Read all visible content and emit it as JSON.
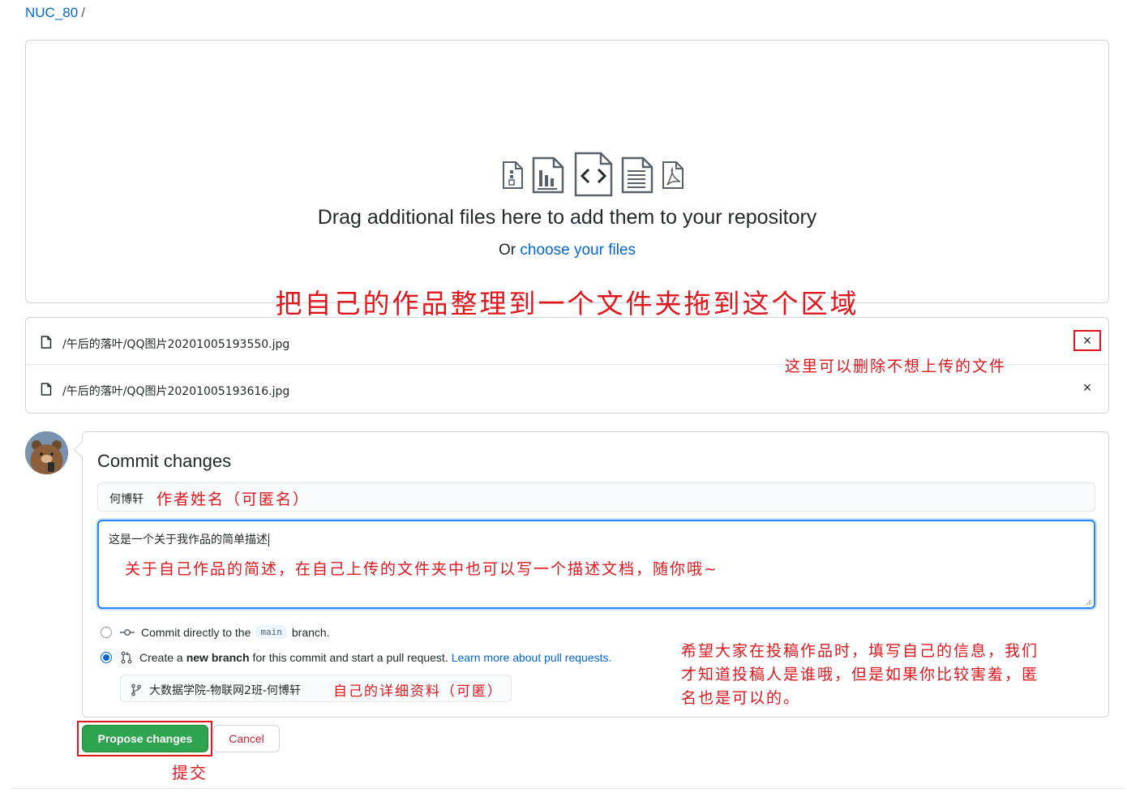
{
  "breadcrumb": {
    "repo": "NUC_80",
    "separator": "/"
  },
  "dropzone": {
    "title": "Drag additional files here to add them to your repository",
    "or_text": "Or",
    "choose_link": "choose your files",
    "annotation": "把自己的作品整理到一个文件夹拖到这个区域",
    "icons": [
      "file-zip-icon",
      "file-chart-icon",
      "file-code-icon",
      "file-text-icon",
      "file-pdf-icon"
    ]
  },
  "files": {
    "items": [
      {
        "name": "/午后的落叶/QQ图片20201005193550.jpg",
        "remove": "×"
      },
      {
        "name": "/午后的落叶/QQ图片20201005193616.jpg",
        "remove": "×"
      }
    ],
    "annotation": "这里可以删除不想上传的文件"
  },
  "commit": {
    "title": "Commit changes",
    "summary_value": "何博轩",
    "summary_annotation": "作者姓名（可匿名）",
    "description_value": "这是一个关于我作品的简单描述",
    "description_annotation": "关于自己作品的简述，在自己上传的文件夹中也可以写一个描述文档，随你哦~",
    "option_direct": {
      "prefix": "Commit directly to the",
      "branch": "main",
      "suffix": "branch."
    },
    "option_new": {
      "prefix": "Create a",
      "bold": "new branch",
      "suffix": "for this commit and start a pull request.",
      "link": "Learn more about pull requests."
    },
    "branch_value": "大数据学院-物联网2班-何博轩",
    "branch_annotation": "自己的详细资料（可匿）",
    "side_annotation": "希望大家在投稿作品时，填写自己的信息，我们才知道投稿人是谁哦，但是如果你比较害羞，匿名也是可以的。"
  },
  "actions": {
    "propose": "Propose changes",
    "cancel": "Cancel",
    "submit_annotation": "提交"
  },
  "colors": {
    "accent": "#0366d6",
    "primary_button": "#2ea44f",
    "annotation": "#e0161d",
    "danger": "#cb2431"
  }
}
